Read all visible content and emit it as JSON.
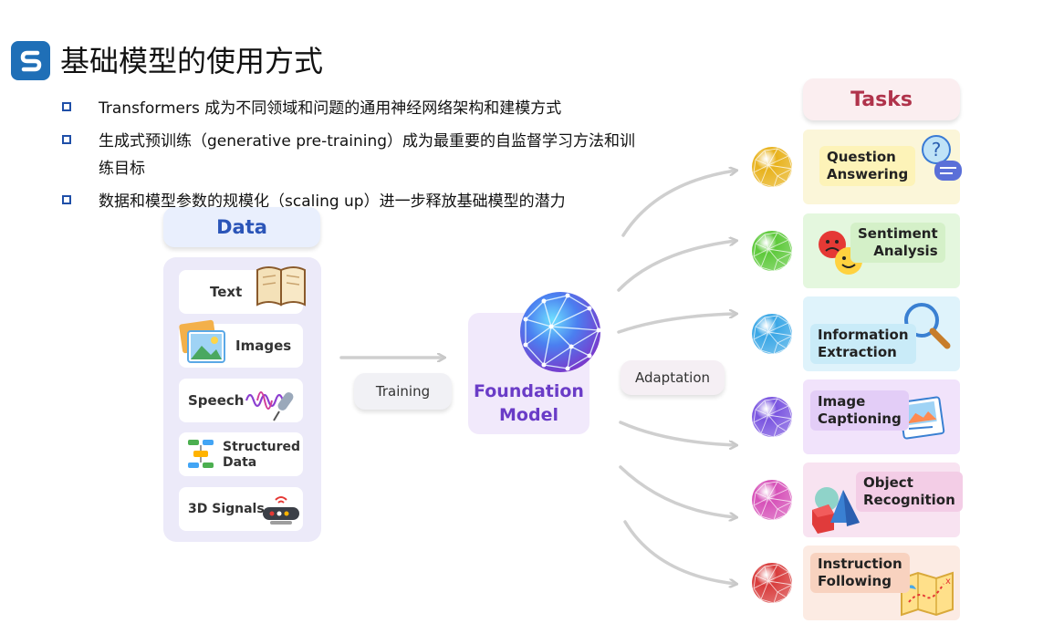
{
  "page_title": "基础模型的使用方式",
  "bullets": [
    "Transformers 成为不同领域和问题的通用神经网络架构和建模方式",
    "生成式预训练（generative pre-training）成为最重要的自监督学习方法和训练目标",
    "数据和模型参数的规模化（scaling up）进一步释放基础模型的潜力"
  ],
  "bullet_1_line1": "生成式预训练（generative pre-training）成为最重要的自监督学习方法和训",
  "bullet_1_line2": "练目标",
  "data_header": "Data",
  "data_items": [
    "Text",
    "Images",
    "Speech",
    "Structured Data",
    "3D Signals"
  ],
  "structured_line1": "Structured",
  "structured_line2": "Data",
  "training_label": "Training",
  "foundation_line1": "Foundation",
  "foundation_line2": "Model",
  "adaptation_label": "Adaptation",
  "tasks_header": "Tasks",
  "tasks": [
    {
      "line1": "Question",
      "line2": "Answering",
      "color": "#fbf6d9",
      "orb": "#e8b21c"
    },
    {
      "line1": "Sentiment",
      "line2": "Analysis",
      "color": "#e4f7de",
      "orb": "#5dc93a"
    },
    {
      "line1": "Information",
      "line2": "Extraction",
      "color": "#dff3fb",
      "orb": "#3aa7e6"
    },
    {
      "line1": "Image",
      "line2": "Captioning",
      "color": "#f1e3fb",
      "orb": "#7a55e0"
    },
    {
      "line1": "Object",
      "line2": "Recognition",
      "color": "#f8e3f1",
      "orb": "#d651b8"
    },
    {
      "line1": "Instruction",
      "line2": "Following",
      "color": "#fcebe3",
      "orb": "#d83b3b"
    }
  ]
}
